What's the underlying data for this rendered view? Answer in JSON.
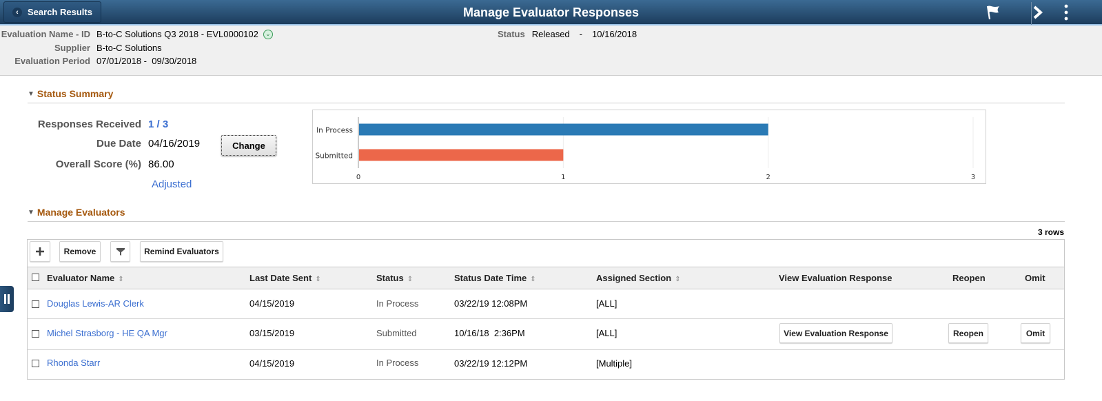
{
  "banner": {
    "back_label": "Search Results",
    "title": "Manage Evaluator Responses",
    "icons": [
      "flag-icon",
      "chevron-right-icon",
      "more-vertical-icon"
    ]
  },
  "header": {
    "evaluation_name_label": "Evaluation Name - ID",
    "evaluation_name_value": "B-to-C Solutions Q3 2018 - EVL0000102",
    "supplier_label": "Supplier",
    "supplier_value": "B-to-C Solutions",
    "period_label": "Evaluation Period",
    "period_value": "07/01/2018 -  09/30/2018",
    "status_label": "Status",
    "status_value": "Released",
    "status_sep": "-",
    "status_date": "10/16/2018"
  },
  "status_summary": {
    "title": "Status Summary",
    "responses_label": "Responses Received",
    "responses_value": "1 / 3",
    "due_date_label": "Due Date",
    "due_date_value": "04/16/2019",
    "change_label": "Change",
    "overall_score_label": "Overall Score (%)",
    "overall_score_value": "86.00",
    "adjusted_label": "Adjusted"
  },
  "chart_data": {
    "type": "bar",
    "orientation": "horizontal",
    "categories": [
      "In Process",
      "Submitted"
    ],
    "values": [
      2,
      1
    ],
    "colors": [
      "#2a7ab5",
      "#ec674a"
    ],
    "title": "",
    "xlabel": "",
    "ylabel": "",
    "xlim": [
      0,
      3
    ],
    "xticks": [
      "0",
      "1",
      "2",
      "3"
    ],
    "grid": true
  },
  "manage_evaluators": {
    "title": "Manage Evaluators",
    "row_count": "3 rows",
    "toolbar": {
      "add_icon": "plus-icon",
      "remove_label": "Remove",
      "filter_icon": "filter-icon",
      "remind_label": "Remind Evaluators"
    },
    "columns": [
      "Evaluator Name",
      "Last Date Sent",
      "Status",
      "Status Date Time",
      "Assigned Section",
      "View Evaluation Response",
      "Reopen",
      "Omit"
    ],
    "rows": [
      {
        "name": "Douglas Lewis-AR Clerk",
        "last_sent": "04/15/2019",
        "status": "In Process",
        "status_dt": "03/22/19 12:08PM",
        "section": "[ALL]",
        "view": "",
        "reopen": "",
        "omit": ""
      },
      {
        "name": "Michel Strasborg - HE QA Mgr",
        "last_sent": "03/15/2019",
        "status": "Submitted",
        "status_dt": "10/16/18  2:36PM",
        "section": "[ALL]",
        "view": "View Evaluation Response",
        "reopen": "Reopen",
        "omit": "Omit"
      },
      {
        "name": "Rhonda Starr",
        "last_sent": "04/15/2019",
        "status": "In Process",
        "status_dt": "03/22/19 12:12PM",
        "section": "[Multiple]",
        "view": "",
        "reopen": "",
        "omit": ""
      }
    ]
  }
}
